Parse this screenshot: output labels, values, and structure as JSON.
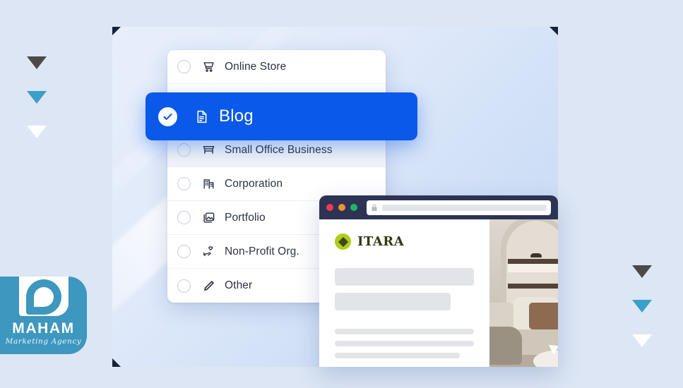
{
  "decor": {
    "triangles_left": [
      {
        "name": "triangle-dark",
        "color": "#4a4a4a"
      },
      {
        "name": "triangle-teal",
        "color": "#3a9fc9"
      },
      {
        "name": "triangle-white",
        "color": "#ffffff"
      }
    ],
    "triangles_right": [
      {
        "name": "triangle-dark",
        "color": "#4a4a4a"
      },
      {
        "name": "triangle-teal",
        "color": "#3a9fc9"
      },
      {
        "name": "triangle-white",
        "color": "#ffffff"
      }
    ],
    "background_color": "#dce6f5"
  },
  "logo": {
    "name": "MAHAM",
    "tagline": "Marketing Agency",
    "brand_color": "#3d97bf"
  },
  "picker": {
    "items": [
      {
        "label": "Online Store",
        "icon": "shopping-cart-icon",
        "selected": false,
        "shaded": false
      },
      {
        "label": "Small Office Business",
        "icon": "storefront-icon",
        "selected": false,
        "shaded": true
      },
      {
        "label": "Corporation",
        "icon": "office-building-icon",
        "selected": false,
        "shaded": false
      },
      {
        "label": "Portfolio",
        "icon": "image-gallery-icon",
        "selected": false,
        "shaded": false
      },
      {
        "label": "Non-Profit Org.",
        "icon": "hand-heart-icon",
        "selected": false,
        "shaded": false
      },
      {
        "label": "Other",
        "icon": "pencil-icon",
        "selected": false,
        "shaded": false
      }
    ],
    "selected_item": {
      "label": "Blog",
      "icon": "document-icon",
      "check_icon": "check-circle-icon",
      "accent_color": "#0b59e8"
    }
  },
  "browser": {
    "traffic_lights": [
      "#ec3b57",
      "#f0932b",
      "#20b667"
    ],
    "titlebar_color": "#2d3355",
    "url_value": "",
    "url_placeholder": "",
    "lock_icon": "lock-icon",
    "site": {
      "brand": "ITARA",
      "brand_mark_color": "#b0cc1d",
      "brand_text_color": "#2f3d0c",
      "placeholder_blocks": 5,
      "photo_alt": "living-room-interior-photo"
    }
  }
}
